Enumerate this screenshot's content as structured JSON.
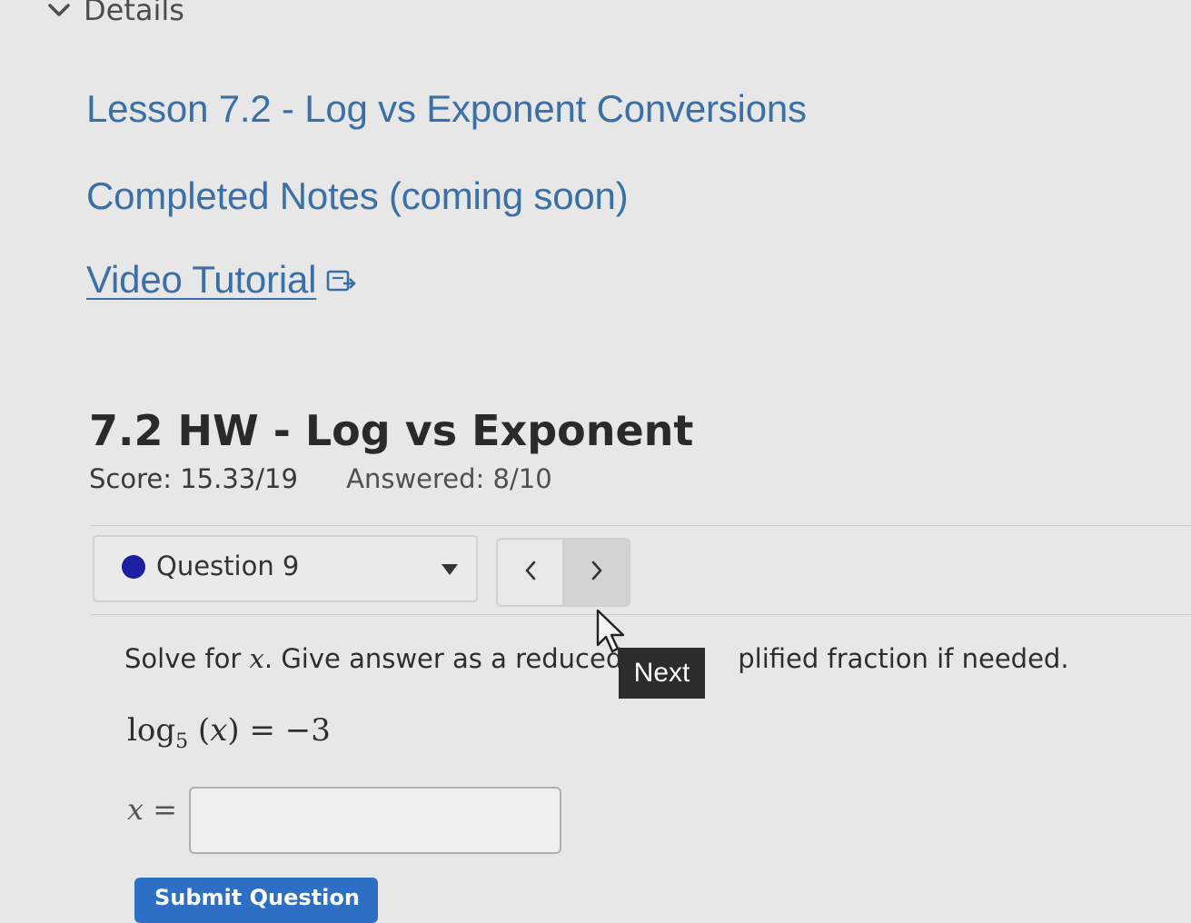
{
  "details": {
    "label": "Details"
  },
  "links": {
    "lesson": "Lesson 7.2 - Log vs Exponent Conversions",
    "notes": "Completed Notes (coming soon)",
    "video": "Video Tutorial"
  },
  "assignment": {
    "title": "7.2 HW - Log vs Exponent",
    "score": "Score: 15.33/19",
    "answered": "Answered: 8/10"
  },
  "question_nav": {
    "selected": "Question 9",
    "status_color": "#1c1fa0",
    "prev_icon": "chevron-left-icon",
    "next_icon": "chevron-right-icon",
    "tooltip": "Next"
  },
  "question": {
    "prefix": "Solve for ",
    "variable": "x",
    "suffix_before_tooltip": ". Give answer as a reduced a",
    "suffix_after_tooltip": "plified fraction if needed.",
    "equation": {
      "func": "log",
      "base": "5",
      "arg": "x",
      "rhs": "−3"
    },
    "answer_label": "x",
    "answer_value": ""
  },
  "submit": {
    "label": "Submit Question"
  },
  "colors": {
    "link": "#3b6fa8",
    "submit": "#2c6fc4",
    "tooltip_bg": "#2c2c2c"
  }
}
